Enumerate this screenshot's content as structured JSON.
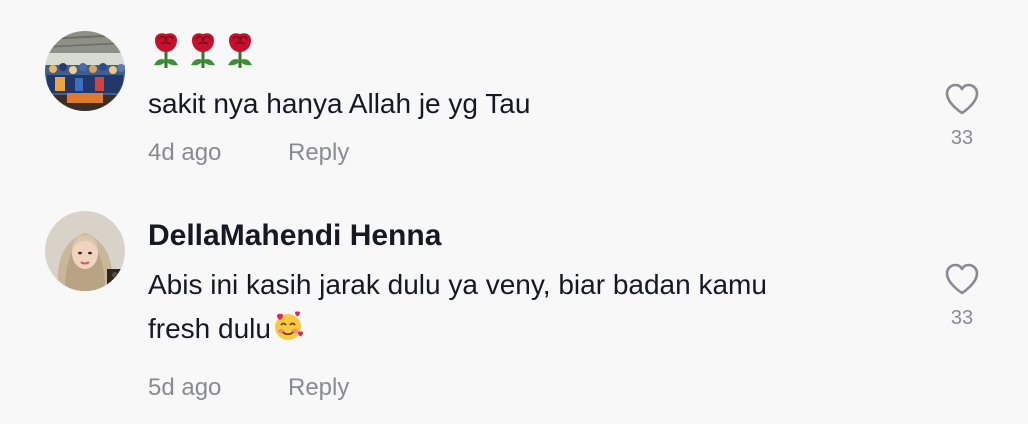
{
  "comments": [
    {
      "username": "🌹🌹🌹",
      "text": "sakit nya hanya Allah je yg Tau",
      "date": "4d ago",
      "reply_label": "Reply",
      "likes": "33",
      "avatar_icon": "group-photo-avatar",
      "username_icon": "rose-emoji"
    },
    {
      "username": "DellaMahendi Henna",
      "text_line1": "Abis ini kasih jarak dulu ya veny, biar badan kamu",
      "text_line2": "fresh dulu",
      "text_emoji": "smiling-face-with-hearts-emoji",
      "date": "5d ago",
      "reply_label": "Reply",
      "likes": "33",
      "avatar_icon": "woman-hijab-avatar"
    }
  ],
  "colors": {
    "background": "#f8f8f8",
    "primary_text": "#161823",
    "secondary_text": "#8a8b91"
  }
}
